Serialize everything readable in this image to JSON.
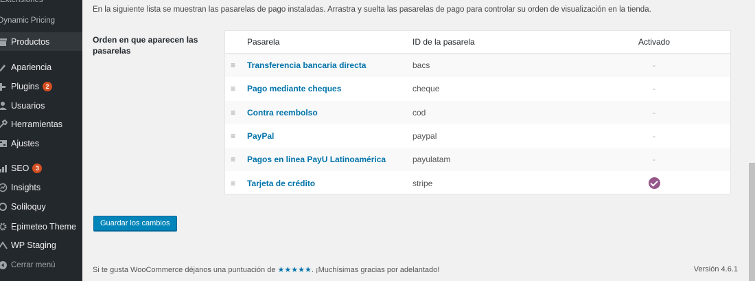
{
  "sidebar": {
    "submenu": [
      "Extensiones",
      "Dynamic Pricing"
    ],
    "items": [
      {
        "label": "Productos",
        "icon": "archive-icon",
        "badge": ""
      },
      {
        "label": "Apariencia",
        "icon": "brush-icon",
        "badge": ""
      },
      {
        "label": "Plugins",
        "icon": "plugin-icon",
        "badge": "2"
      },
      {
        "label": "Usuarios",
        "icon": "users-icon",
        "badge": ""
      },
      {
        "label": "Herramientas",
        "icon": "wrench-icon",
        "badge": ""
      },
      {
        "label": "Ajustes",
        "icon": "settings-icon",
        "badge": ""
      },
      {
        "label": "SEO",
        "icon": "seo-icon",
        "badge": "3"
      },
      {
        "label": "Insights",
        "icon": "chart-icon",
        "badge": ""
      },
      {
        "label": "Soliloquy",
        "icon": "slider-icon",
        "badge": ""
      },
      {
        "label": "Epimeteo Theme",
        "icon": "gear-icon",
        "badge": ""
      },
      {
        "label": "WP Staging",
        "icon": "staging-icon",
        "badge": ""
      }
    ],
    "collapse_label": "Cerrar menú"
  },
  "main": {
    "description": "En la siguiente lista se muestran las pasarelas de pago instaladas. Arrastra y suelta las pasarelas de pago para controlar su orden de visualización en la tienda.",
    "field_label": "Orden en que aparecen las pasarelas",
    "table": {
      "headers": {
        "name": "Pasarela",
        "id": "ID de la pasarela",
        "enabled": "Activado"
      },
      "rows": [
        {
          "name": "Transferencia bancaria directa",
          "id": "bacs",
          "enabled": "-"
        },
        {
          "name": "Pago mediante cheques",
          "id": "cheque",
          "enabled": "-"
        },
        {
          "name": "Contra reembolso",
          "id": "cod",
          "enabled": "-"
        },
        {
          "name": "PayPal",
          "id": "paypal",
          "enabled": "-"
        },
        {
          "name": "Pagos en linea PayU Latinoamérica",
          "id": "payulatam",
          "enabled": "-"
        },
        {
          "name": "Tarjeta de crédito",
          "id": "stripe",
          "enabled": "check"
        }
      ]
    },
    "save_label": "Guardar los cambios"
  },
  "footer": {
    "prefix": "Si te gusta ",
    "brand": "WooCommerce",
    "middle": " déjanos una puntuación de ",
    "stars": "★★★★★",
    "suffix": ". ¡Muchísimas gracias por adelantado!",
    "version": "Versión 4.6.1"
  },
  "colors": {
    "accent": "#0073aa",
    "button": "#0085ba",
    "sidebar_bg": "#23282d",
    "badge": "#d54e21",
    "check": "#96588a"
  }
}
